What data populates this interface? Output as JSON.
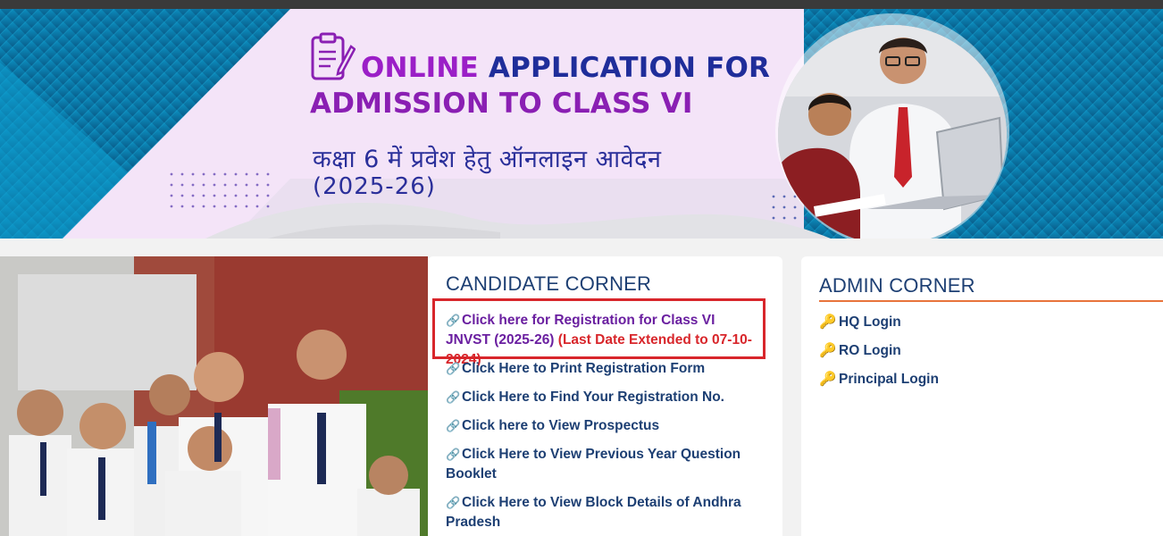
{
  "banner": {
    "title_word1": "ONLINE",
    "title_rest1": "APPLICATION FOR",
    "title_line2": "ADMISSION TO CLASS VI",
    "hindi_title": "कक्षा 6 में प्रवेश हेतु ऑनलाइन आवेदन",
    "session": "(2025-26)"
  },
  "candidate_corner": {
    "title": "CANDIDATE CORNER",
    "registration_link": "Click here for Registration for Class VI JNVST (2025-26)",
    "registration_note": "(Last Date Extended to 07-10-2024)",
    "links": [
      "Click Here to Print Registration Form",
      "Click Here to Find Your Registration No.",
      "Click here to View Prospectus",
      "Click Here to View Previous Year Question Booklet",
      "Click Here to View Block Details of Andhra Pradesh"
    ]
  },
  "admin_corner": {
    "title": "ADMIN CORNER",
    "links": [
      "HQ Login",
      "RO Login",
      "Principal Login"
    ]
  },
  "colors": {
    "accent_orange": "#e8742a",
    "navy": "#1d3f73",
    "highlight_red": "#d8262b",
    "banner_purple": "#9b1fc7"
  },
  "icons": {
    "link": "link-icon",
    "login": "key-icon",
    "banner": "clipboard-icon"
  }
}
